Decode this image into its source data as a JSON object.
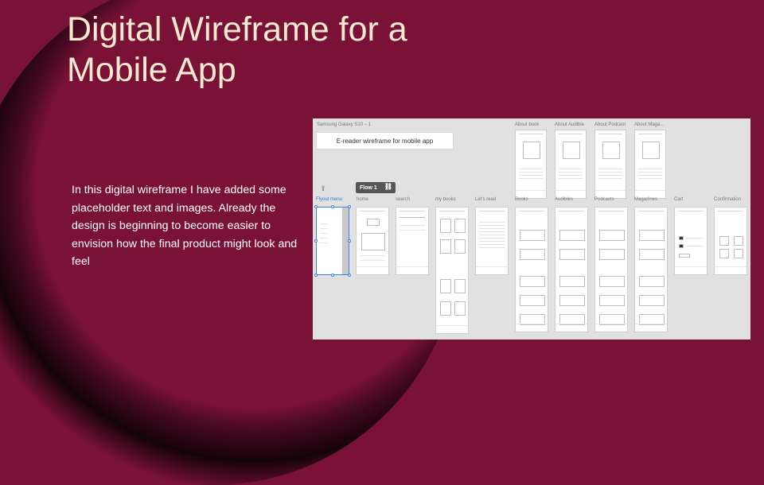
{
  "slide": {
    "title": "Digital Wireframe for a Mobile App",
    "description": "In this digital wireframe I have added some placeholder text and images. Already the design is beginning to become easier to envision how the final product might look and feel"
  },
  "screenshot": {
    "device_label": "Samsung Galaxy S10 – 1",
    "wireframe_title": "E-reader wireframe for mobile app",
    "flow_label": "Flow 1",
    "top_artboards": [
      "About book",
      "About Audible",
      "About Podcast",
      "About Maga..."
    ],
    "artboards": [
      "Flyout menu",
      "home",
      "search",
      "my books",
      "Let's read",
      "Books",
      "Audibles",
      "Podcasts",
      "Magazines",
      "Cart",
      "Confirmation"
    ]
  },
  "colors": {
    "background": "#7a1237",
    "title": "#f8ead0",
    "canvas": "#e1e1e1",
    "selection": "#3b82e0"
  },
  "icons": {
    "share": "share-icon",
    "link": "link-icon"
  }
}
